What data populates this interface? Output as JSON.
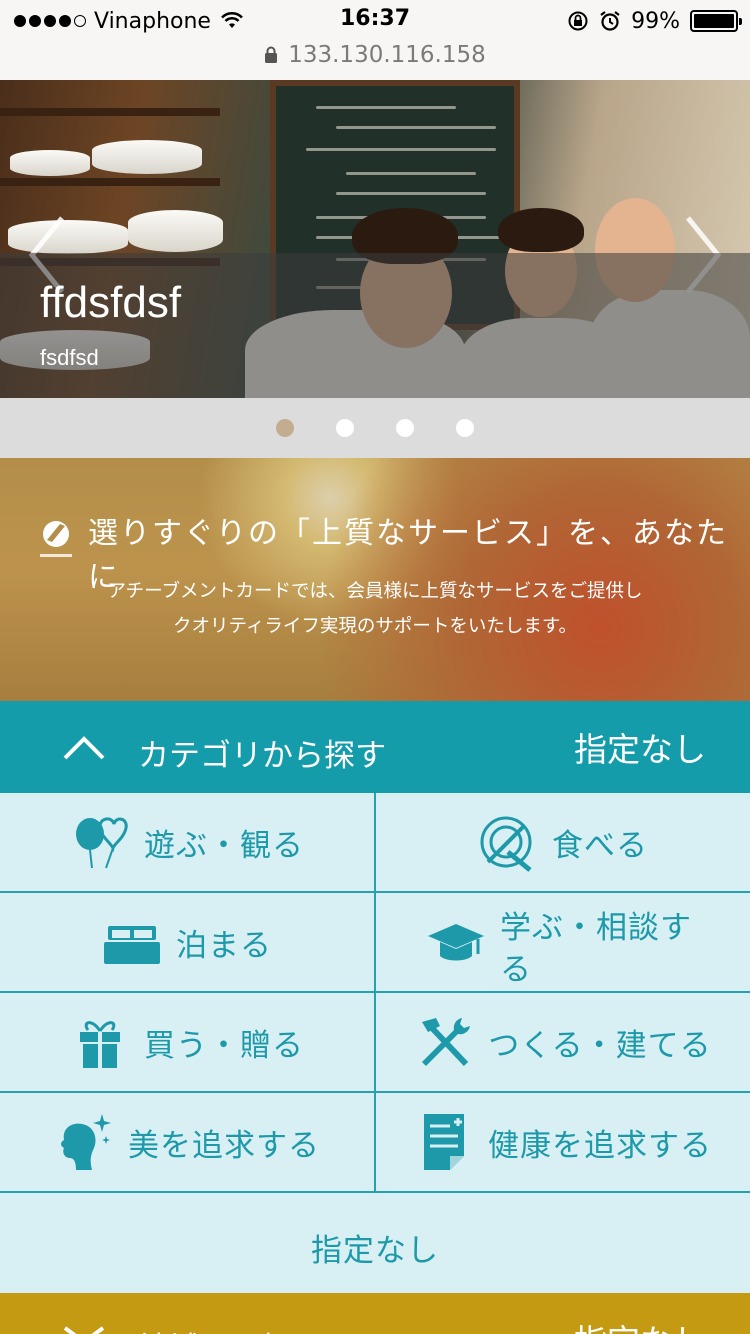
{
  "status_bar": {
    "carrier": "Vinaphone",
    "time": "16:37",
    "battery_percent": "99%",
    "battery_level": 0.99,
    "signal_bars_filled": 4,
    "signal_bars_total": 5,
    "url": "133.130.116.158"
  },
  "hero": {
    "title": "ffdsfdsf",
    "subtitle": "fsdfsd",
    "active_slide": 1,
    "slide_count": 4
  },
  "banner": {
    "title": "選りすぐりの「上質なサービス」を、あなたに",
    "line1": "アチーブメントカードでは、会員様に上質なサービスをご提供し",
    "line2": "クオリティライフ実現のサポートをいたします。"
  },
  "category": {
    "header_title": "カテゴリから探す",
    "selected": "指定なし",
    "items": [
      {
        "label": "遊ぶ・観る",
        "icon": "balloons-icon"
      },
      {
        "label": "食べる",
        "icon": "dining-plate-icon"
      },
      {
        "label": "泊まる",
        "icon": "bed-icon"
      },
      {
        "label": "学ぶ・相談する",
        "icon": "graduation-cap-icon"
      },
      {
        "label": "買う・贈る",
        "icon": "gift-icon"
      },
      {
        "label": "つくる・建てる",
        "icon": "tools-icon"
      },
      {
        "label": "美を追求する",
        "icon": "beauty-face-icon"
      },
      {
        "label": "健康を追求する",
        "icon": "document-icon"
      }
    ],
    "none_label": "指定なし"
  },
  "area": {
    "header_title": "地域から探す",
    "selected": "指定なし"
  },
  "colors": {
    "teal": "#159cab",
    "teal_light": "#d8eff3",
    "gold": "#c49a12",
    "pager_active": "#c4ad8e"
  }
}
